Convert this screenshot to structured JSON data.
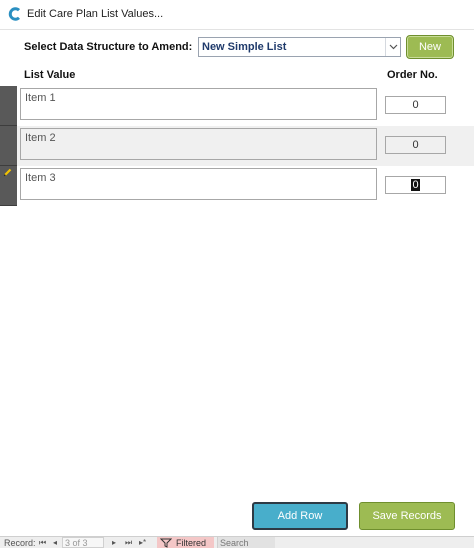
{
  "window": {
    "title": "Edit Care Plan List Values...",
    "icon": "care-app-icon"
  },
  "header": {
    "select_label": "Select Data Structure to Amend:",
    "selected_structure": "New Simple List",
    "new_button": "New"
  },
  "columns": {
    "list_value": "List Value",
    "order_no": "Order No."
  },
  "rows": [
    {
      "item": "Item 1",
      "order": "0"
    },
    {
      "item": "Item 2",
      "order": "0"
    },
    {
      "item": "Item 3",
      "order": "0"
    }
  ],
  "footer": {
    "add_row": "Add Row",
    "save_records": "Save Records"
  },
  "nav": {
    "record_label": "Record:",
    "first": "⏮",
    "prev": "◂",
    "position": "3 of 3",
    "next": "▸",
    "last": "⏭",
    "new": "▸*",
    "filter": "Filtered",
    "search": "Search"
  },
  "colors": {
    "green": "#9dbb53",
    "blue": "#48aecb",
    "filter_bg": "#f4c7c7"
  }
}
